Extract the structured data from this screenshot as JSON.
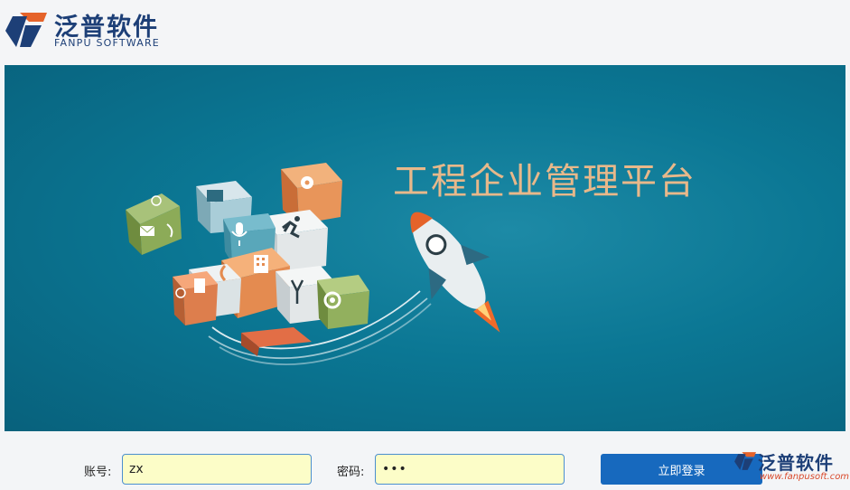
{
  "header": {
    "logo_cn": "泛普软件",
    "logo_en": "FANPU SOFTWARE"
  },
  "banner": {
    "title": "工程企业管理平台",
    "cube_icons": [
      "map-pin-icon",
      "runner-icon",
      "microphone-icon",
      "id-card-icon",
      "phone-icon",
      "mail-icon",
      "globe-icon",
      "link-icon",
      "calculator-icon",
      "antenna-icon",
      "document-icon",
      "music-icon",
      "spinner-icon"
    ],
    "rocket_icon": "rocket-icon"
  },
  "login": {
    "account_label": "账号:",
    "account_value": "zx",
    "password_label": "密码:",
    "password_value": "•••",
    "submit_label": "立即登录"
  },
  "watermark": {
    "cn": "泛普软件",
    "url": "www.fanpusoft.com"
  },
  "colors": {
    "brand_blue": "#1d3f77",
    "brand_orange": "#e5632a",
    "button_blue": "#1769be",
    "input_bg": "#fcfdc8",
    "banner_teal": "#0b7794",
    "title_peach": "#e8b88a"
  }
}
